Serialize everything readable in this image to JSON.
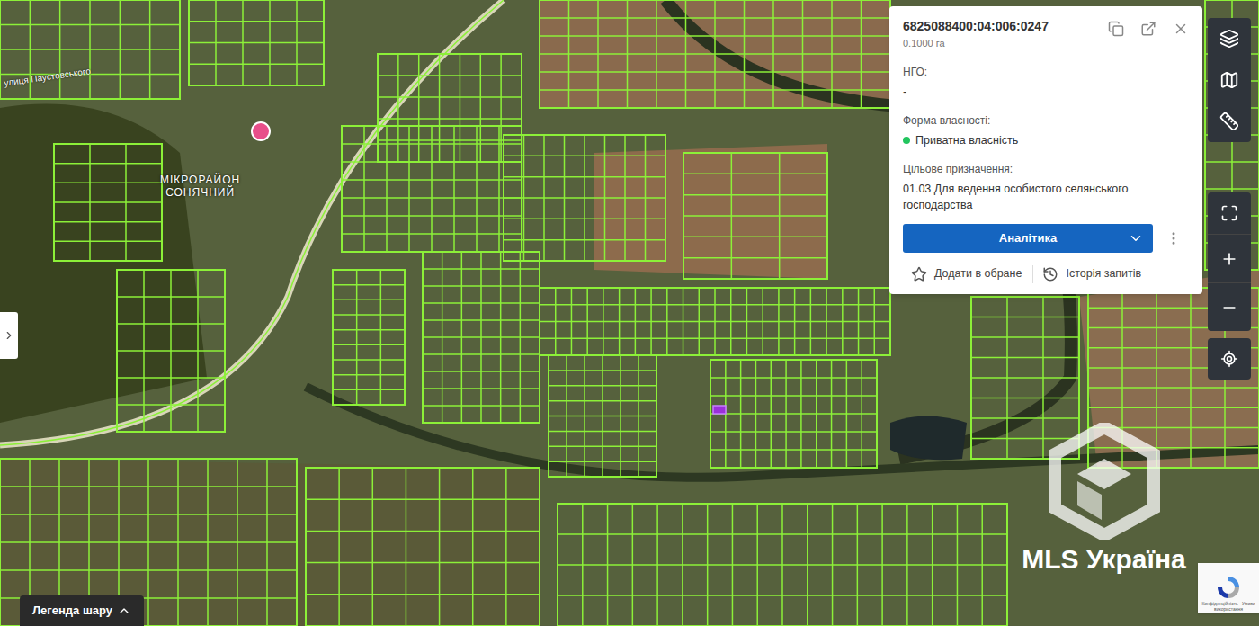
{
  "map": {
    "street_label": "улиця Паустовського",
    "district_label": [
      "МІКРОРАЙОН",
      "СОНЯЧНИЙ"
    ]
  },
  "parcel_popup": {
    "cadastral_number": "6825088400:04:006:0247",
    "area": "0.1000 га",
    "fields": [
      {
        "label": "НГО:",
        "value": "-",
        "dot": false,
        "color": "#000000"
      },
      {
        "label": "Форма власності:",
        "value": "Приватна власність",
        "dot": true,
        "color": "#22c55e"
      },
      {
        "label": "Цільове призначення:",
        "value": "01.03 Для ведення особистого селянського господарства",
        "dot": false,
        "color": "#000000"
      }
    ],
    "analytics_button": "Аналітика",
    "actions": [
      "Додати в обране",
      "Історія запитів"
    ]
  },
  "legend": {
    "label": "Легенда шару",
    "expanded": false
  },
  "watermark": "MLS Україна",
  "recaptcha": "Конфіденційність - Умови використання"
}
